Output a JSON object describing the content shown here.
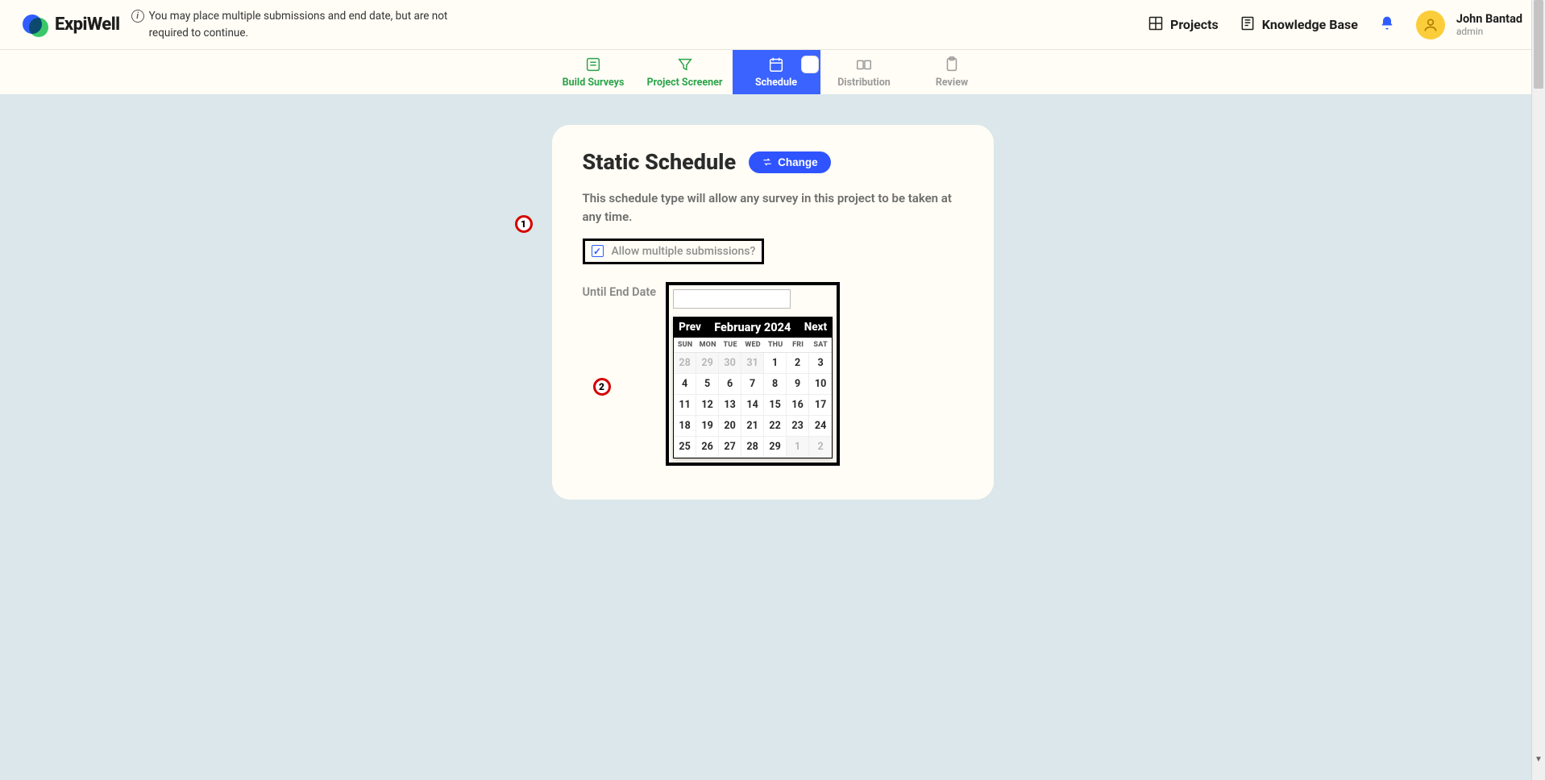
{
  "header": {
    "brand": "ExpiWell",
    "info_text": "You may place multiple submissions and end date, but are not required to continue.",
    "projects_label": "Projects",
    "kb_label": "Knowledge Base",
    "user_name": "John Bantad",
    "user_role": "admin"
  },
  "tabs": {
    "build": "Build Surveys",
    "screener": "Project Screener",
    "schedule": "Schedule",
    "distribution": "Distribution",
    "review": "Review"
  },
  "card": {
    "title": "Static Schedule",
    "change_label": "Change",
    "description": "This schedule type will allow any survey in this project to be taken at any time.",
    "allow_multi_label": "Allow multiple submissions?",
    "end_date_label": "Until End Date",
    "date_value": ""
  },
  "calendar": {
    "prev": "Prev",
    "next": "Next",
    "month_title": "February 2024",
    "dow": [
      "SUN",
      "MON",
      "TUE",
      "WED",
      "THU",
      "FRI",
      "SAT"
    ],
    "weeks": [
      [
        {
          "d": "28",
          "o": true
        },
        {
          "d": "29",
          "o": true
        },
        {
          "d": "30",
          "o": true
        },
        {
          "d": "31",
          "o": true
        },
        {
          "d": "1"
        },
        {
          "d": "2"
        },
        {
          "d": "3"
        }
      ],
      [
        {
          "d": "4"
        },
        {
          "d": "5"
        },
        {
          "d": "6"
        },
        {
          "d": "7"
        },
        {
          "d": "8"
        },
        {
          "d": "9"
        },
        {
          "d": "10"
        }
      ],
      [
        {
          "d": "11"
        },
        {
          "d": "12"
        },
        {
          "d": "13"
        },
        {
          "d": "14"
        },
        {
          "d": "15"
        },
        {
          "d": "16"
        },
        {
          "d": "17"
        }
      ],
      [
        {
          "d": "18"
        },
        {
          "d": "19"
        },
        {
          "d": "20"
        },
        {
          "d": "21"
        },
        {
          "d": "22"
        },
        {
          "d": "23"
        },
        {
          "d": "24"
        }
      ],
      [
        {
          "d": "25"
        },
        {
          "d": "26"
        },
        {
          "d": "27"
        },
        {
          "d": "28"
        },
        {
          "d": "29"
        },
        {
          "d": "1",
          "o": true
        },
        {
          "d": "2",
          "o": true
        }
      ]
    ]
  },
  "annotations": {
    "marker1": "1",
    "marker2": "2"
  }
}
